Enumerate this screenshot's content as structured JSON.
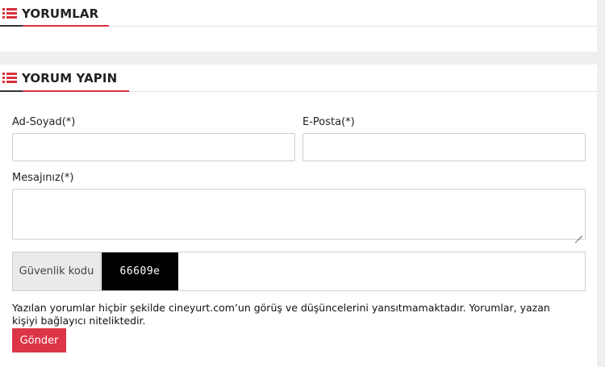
{
  "comments_section": {
    "title": "YORUMLAR",
    "icon": "list-icon",
    "accent_color": "#d8323c"
  },
  "comment_form": {
    "title": "YORUM YAPIN",
    "icon": "list-icon",
    "name_label": "Ad-Soyad(*)",
    "name_value": "",
    "email_label": "E-Posta(*)",
    "email_value": "",
    "message_label": "Mesajınız(*)",
    "message_value": "",
    "captcha_label": "Güvenlik kodu",
    "captcha_code": "66609e",
    "captcha_value": "",
    "notice": "Yazılan yorumlar hiçbir şekilde cineyurt.com’un görüş ve düşüncelerini yansıtmamaktadır. Yorumlar, yazan kişiyi bağlayıcı niteliktedir.",
    "submit_label": "Gönder",
    "submit_color": "#dc3545"
  }
}
